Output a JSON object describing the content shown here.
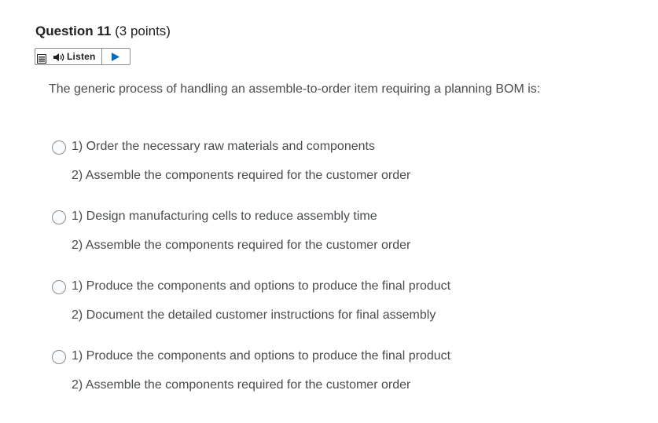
{
  "question": {
    "title": "Question 11",
    "points": "(3 points)",
    "text": "The generic process of handling an assemble-to-order item requiring a planning BOM is:"
  },
  "listen": {
    "label": "Listen",
    "menu_icon": "menu-icon",
    "speaker_icon": "speaker-icon",
    "play_icon": "play-icon"
  },
  "options": [
    {
      "line1": "1)  Order the necessary raw materials and components",
      "line2": "2)  Assemble the components required for the customer order"
    },
    {
      "line1": "1)  Design manufacturing cells to reduce assembly time",
      "line2": "2)  Assemble the components required for the customer order"
    },
    {
      "line1": "1)  Produce the components and options to produce the final product",
      "line2": "2)  Document the detailed customer instructions for final assembly"
    },
    {
      "line1": "1)  Produce the components and options to produce the final product",
      "line2": "2)  Assemble the components required for the customer order"
    }
  ],
  "colors": {
    "title": "#202122",
    "text": "#494c4e",
    "play": "#006fbf",
    "border": "#8a8c8e"
  }
}
